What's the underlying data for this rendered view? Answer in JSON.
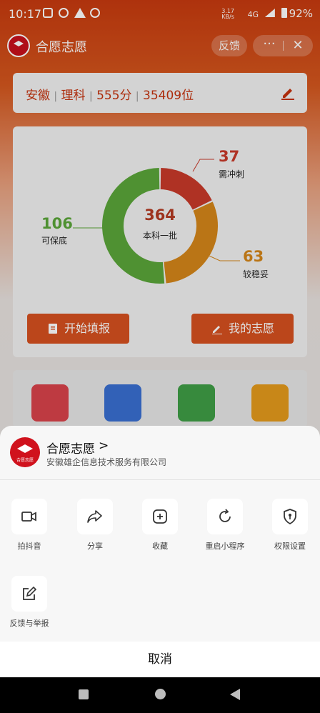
{
  "status_bar": {
    "time": "10:17",
    "net_speed_value": "3.17",
    "net_speed_unit": "KB/s",
    "network": "4G",
    "battery": "92%"
  },
  "title_bar": {
    "app_name": "合愿志愿",
    "feedback": "反馈",
    "more": "···",
    "close": "✕"
  },
  "score": {
    "province": "安徽",
    "subject": "理科",
    "score": "555分",
    "rank": "35409位",
    "separator": "|"
  },
  "chart_data": {
    "type": "pie",
    "center_value": "364",
    "center_label": "本科一批",
    "slices": [
      {
        "label": "需冲刺",
        "value": 37,
        "color": "#c8392a"
      },
      {
        "label": "较稳妥",
        "value": 63,
        "color": "#d4861a"
      },
      {
        "label": "可保底",
        "value": 106,
        "color": "#5aa63a"
      }
    ]
  },
  "buttons": {
    "start": "开始填报",
    "mine": "我的志愿"
  },
  "feature_icons": [
    {
      "icon": "graduation-cap-icon",
      "color": "#d9434a"
    },
    {
      "icon": "book-icon",
      "color": "#3a6fd1"
    },
    {
      "icon": "bar-chart-icon",
      "color": "#3f9e46"
    },
    {
      "icon": "trend-chart-icon",
      "color": "#e49a1c"
    }
  ],
  "sheet": {
    "mini_program_name": "合愿志愿",
    "chevron": ">",
    "company": "安徽雄企信息技术服务有限公司",
    "logo_text": "合愿志愿",
    "actions": [
      {
        "label": "拍抖音",
        "icon": "video-camera-icon"
      },
      {
        "label": "分享",
        "icon": "share-arrow-icon"
      },
      {
        "label": "收藏",
        "icon": "add-favorite-icon"
      },
      {
        "label": "重启小程序",
        "icon": "restart-icon"
      },
      {
        "label": "权限设置",
        "icon": "shield-key-icon"
      },
      {
        "label": "反馈与举报",
        "icon": "edit-report-icon"
      }
    ],
    "cancel": "取消"
  }
}
